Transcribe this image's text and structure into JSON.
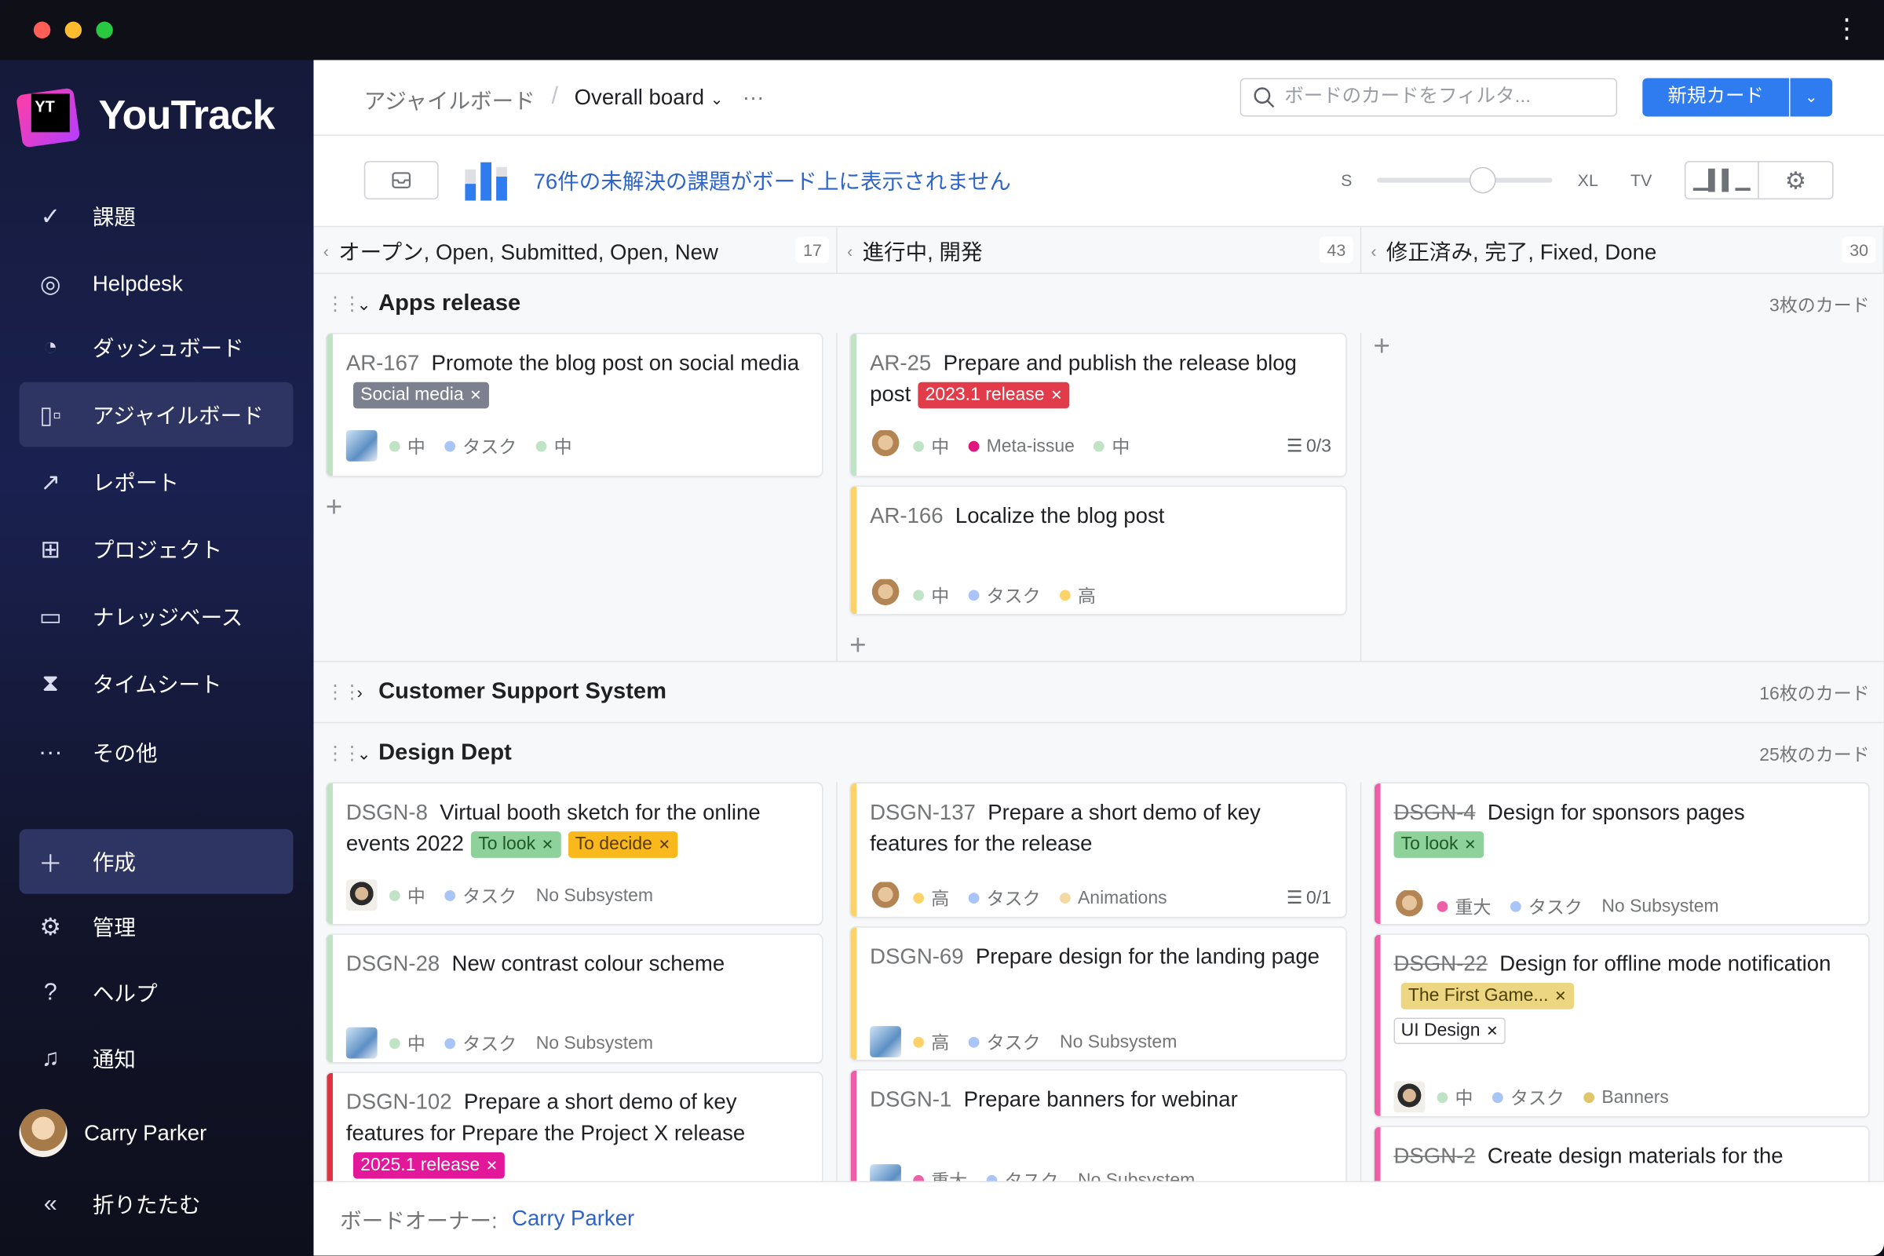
{
  "window": {
    "traffic_lights": [
      "#ff5f57",
      "#febc2e",
      "#28c840"
    ]
  },
  "app": {
    "name": "YouTrack",
    "logo_text": "YT"
  },
  "sidebar": {
    "items": [
      {
        "label": "課題",
        "icon": "check-circle-icon"
      },
      {
        "label": "Helpdesk",
        "icon": "lifebuoy-icon"
      },
      {
        "label": "ダッシュボード",
        "icon": "gauge-icon"
      },
      {
        "label": "アジャイルボード",
        "icon": "board-icon",
        "active": true
      },
      {
        "label": "レポート",
        "icon": "chart-icon"
      },
      {
        "label": "プロジェクト",
        "icon": "grid-icon"
      },
      {
        "label": "ナレッジベース",
        "icon": "book-icon"
      },
      {
        "label": "タイムシート",
        "icon": "hourglass-icon"
      },
      {
        "label": "その他",
        "icon": "more-icon"
      }
    ],
    "create": "作成",
    "bottom": [
      {
        "label": "管理",
        "icon": "gear-icon"
      },
      {
        "label": "ヘルプ",
        "icon": "help-icon"
      },
      {
        "label": "通知",
        "icon": "bell-icon"
      }
    ],
    "user": "Carry Parker",
    "collapse": "折りたたむ"
  },
  "header": {
    "breadcrumb_root": "アジャイルボード",
    "board_name": "Overall board",
    "search_placeholder": "ボードのカードをフィルタ...",
    "new_card": "新規カード"
  },
  "toolbar": {
    "notice": "76件の未解決の課題がボード上に表示されません",
    "sizes": [
      "S",
      "XL",
      "TV"
    ],
    "size_level": 0.6
  },
  "columns": [
    {
      "title": "オープン, Open, Submitted, Open, New",
      "count": "17"
    },
    {
      "title": "進行中, 開発",
      "count": "43"
    },
    {
      "title": "修正済み, 完了, Fixed, Done",
      "count": "30"
    }
  ],
  "swimlanes": [
    {
      "name": "Apps release",
      "count": "3枚のカード",
      "expanded": true,
      "columns": [
        [
          {
            "id": "AR-167",
            "summary": "Promote the blog post on social media",
            "stripe": "#bfe3c4",
            "tags": [
              {
                "label": "Social media",
                "bg": "#7d808f",
                "fg": "#ffffff"
              }
            ],
            "avatar": "man",
            "fields": [
              {
                "dot": "#bfe3c4",
                "label": "中"
              },
              {
                "dot": "#a9c4f7",
                "label": "タスク"
              },
              {
                "dot": "#bfe3c4",
                "label": "中"
              }
            ]
          }
        ],
        [
          {
            "id": "AR-25",
            "summary": "Prepare and publish the release blog post",
            "stripe": "#bfe3c4",
            "tags": [
              {
                "label": "2023.1 release",
                "bg": "#e23b4a",
                "fg": "#ffffff"
              }
            ],
            "avatar": "woman",
            "fields": [
              {
                "dot": "#bfe3c4",
                "label": "中"
              },
              {
                "dot": "#e0177e",
                "label": "Meta-issue"
              },
              {
                "dot": "#bfe3c4",
                "label": "中"
              }
            ],
            "subtasks": "0/3"
          },
          {
            "id": "AR-166",
            "summary": "Localize the blog post",
            "stripe": "#fdd26b",
            "tags": [],
            "avatar": "woman",
            "fields": [
              {
                "dot": "#bfe3c4",
                "label": "中"
              },
              {
                "dot": "#a9c4f7",
                "label": "タスク"
              },
              {
                "dot": "#fdd26b",
                "label": "高"
              }
            ]
          }
        ],
        []
      ]
    },
    {
      "name": "Customer Support System",
      "count": "16枚のカード",
      "expanded": false
    },
    {
      "name": "Design Dept",
      "count": "25枚のカード",
      "expanded": true,
      "columns": [
        [
          {
            "id": "DSGN-8",
            "summary": "Virtual booth sketch for the online events 2022",
            "stripe": "#bfe3c4",
            "tags": [
              {
                "label": "To look",
                "bg": "#8fd19a",
                "fg": "#1d5a27"
              },
              {
                "label": "To decide",
                "bg": "#f9b81c",
                "fg": "#5a3b00"
              }
            ],
            "avatar": "man2",
            "fields": [
              {
                "dot": "#bfe3c4",
                "label": "中"
              },
              {
                "dot": "#a9c4f7",
                "label": "タスク"
              },
              {
                "dot": "",
                "label": "No Subsystem"
              }
            ]
          },
          {
            "id": "DSGN-28",
            "summary": "New contrast colour scheme",
            "stripe": "#bfe3c4",
            "tags": [],
            "avatar": "man",
            "fields": [
              {
                "dot": "#bfe3c4",
                "label": "中"
              },
              {
                "dot": "#a9c4f7",
                "label": "タスク"
              },
              {
                "dot": "",
                "label": "No Subsystem"
              }
            ]
          },
          {
            "id": "DSGN-102",
            "summary": "Prepare a short demo of key features for Prepare the Project X release",
            "stripe": "#e0323f",
            "tags": [
              {
                "label": "2025.1 release",
                "bg": "#e2179a",
                "fg": "#ffffff"
              }
            ],
            "avatar": "",
            "fields": []
          }
        ],
        [
          {
            "id": "DSGN-137",
            "summary": "Prepare a short demo of key features for the release",
            "stripe": "#fdd26b",
            "tags": [],
            "avatar": "woman",
            "fields": [
              {
                "dot": "#fdd26b",
                "label": "高"
              },
              {
                "dot": "#a9c4f7",
                "label": "タスク"
              },
              {
                "dot": "#f3d9a4",
                "label": "Animations"
              }
            ],
            "subtasks": "0/1"
          },
          {
            "id": "DSGN-69",
            "summary": "Prepare design for the landing page",
            "stripe": "#fdd26b",
            "tags": [],
            "avatar": "man",
            "fields": [
              {
                "dot": "#fdd26b",
                "label": "高"
              },
              {
                "dot": "#a9c4f7",
                "label": "タスク"
              },
              {
                "dot": "",
                "label": "No Subsystem"
              }
            ]
          },
          {
            "id": "DSGN-1",
            "summary": "Prepare banners for webinar",
            "stripe": "#ee5fa7",
            "tags": [],
            "avatar": "man",
            "fields": [
              {
                "dot": "#ee5fa7",
                "label": "重大"
              },
              {
                "dot": "#a9c4f7",
                "label": "タスク"
              },
              {
                "dot": "",
                "label": "No Subsystem"
              }
            ]
          }
        ],
        [
          {
            "id": "DSGN-4",
            "summary": "Design for sponsors pages",
            "resolved": true,
            "stripe": "#ee5fa7",
            "tags": [
              {
                "label": "To look",
                "bg": "#8fd19a",
                "fg": "#1d5a27",
                "newline": true
              }
            ],
            "avatar": "woman",
            "fields": [
              {
                "dot": "#ee5fa7",
                "label": "重大"
              },
              {
                "dot": "#a9c4f7",
                "label": "タスク"
              },
              {
                "dot": "",
                "label": "No Subsystem"
              }
            ]
          },
          {
            "id": "DSGN-22",
            "summary": "Design for offline mode notification",
            "resolved": true,
            "stripe": "#ee5fa7",
            "tags": [
              {
                "label": "The First Game...",
                "bg": "#ecd682",
                "fg": "#4d4100"
              },
              {
                "label": "UI Design",
                "bg": "#ffffff",
                "fg": "#1f2023",
                "border": "#cfd0d6",
                "newline": true
              }
            ],
            "avatar": "man2",
            "fields": [
              {
                "dot": "#bfe3c4",
                "label": "中"
              },
              {
                "dot": "#a9c4f7",
                "label": "タスク"
              },
              {
                "dot": "#e1c56a",
                "label": "Banners"
              }
            ]
          },
          {
            "id": "DSGN-2",
            "summary": "Create design materials for the",
            "resolved": true,
            "stripe": "#ee5fa7",
            "tags": [],
            "avatar": "",
            "fields": []
          }
        ]
      ]
    }
  ],
  "footer": {
    "owner_label": "ボードオーナー:",
    "owner": "Carry Parker"
  }
}
